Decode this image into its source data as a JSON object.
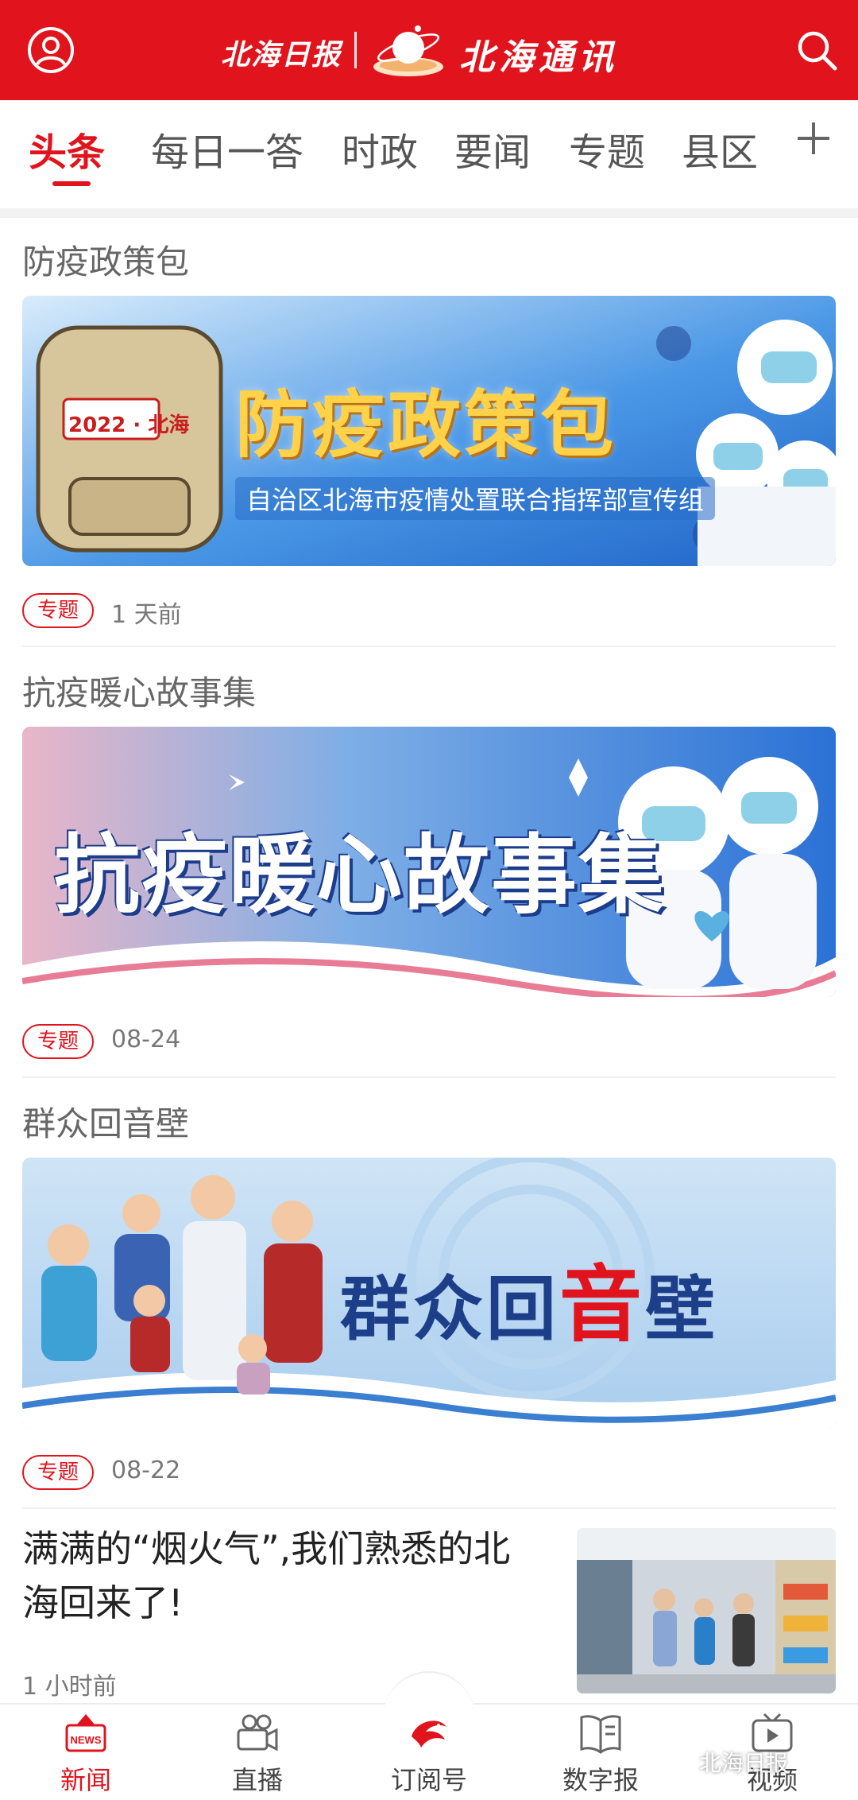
{
  "header": {
    "paper_logo": "北海日报",
    "app_title": "北海通讯",
    "avatar_icon": "user-avatar-icon",
    "search_icon": "search-icon",
    "brand_color": "#e1141d"
  },
  "tabs": {
    "items": [
      "头条",
      "每日一答",
      "时政",
      "要闻",
      "专题",
      "县区"
    ],
    "active": "头条",
    "add_icon": "plus-icon"
  },
  "feed": [
    {
      "title": "防疫政策包",
      "banner_text": "防疫政策包",
      "banner_badge": "2022 · 北海",
      "banner_subtitle": "自治区北海市疫情处置联合指挥部宣传组",
      "tag": "专题",
      "time": "1 天前"
    },
    {
      "title": "抗疫暖心故事集",
      "banner_text": "抗疫暖心故事集",
      "tag": "专题",
      "time": "08-24"
    },
    {
      "title": "群众回音壁",
      "banner_text_a": "群众回",
      "banner_text_b": "音",
      "banner_text_c": "壁",
      "tag": "专题",
      "time": "08-22"
    }
  ],
  "news": {
    "title": "满满的“烟火气”,我们熟悉的北海回来了!",
    "time": "1 小时前"
  },
  "bottom_nav": {
    "items": [
      {
        "label": "新闻",
        "icon": "news-icon",
        "badge": "NEWS"
      },
      {
        "label": "直播",
        "icon": "video-camera-icon"
      },
      {
        "label": "订阅号",
        "icon": "dolphin-logo-icon"
      },
      {
        "label": "数字报",
        "icon": "open-book-icon"
      },
      {
        "label": "视频",
        "icon": "tv-play-icon"
      }
    ],
    "active": "新闻"
  },
  "watermark": "北海日报"
}
